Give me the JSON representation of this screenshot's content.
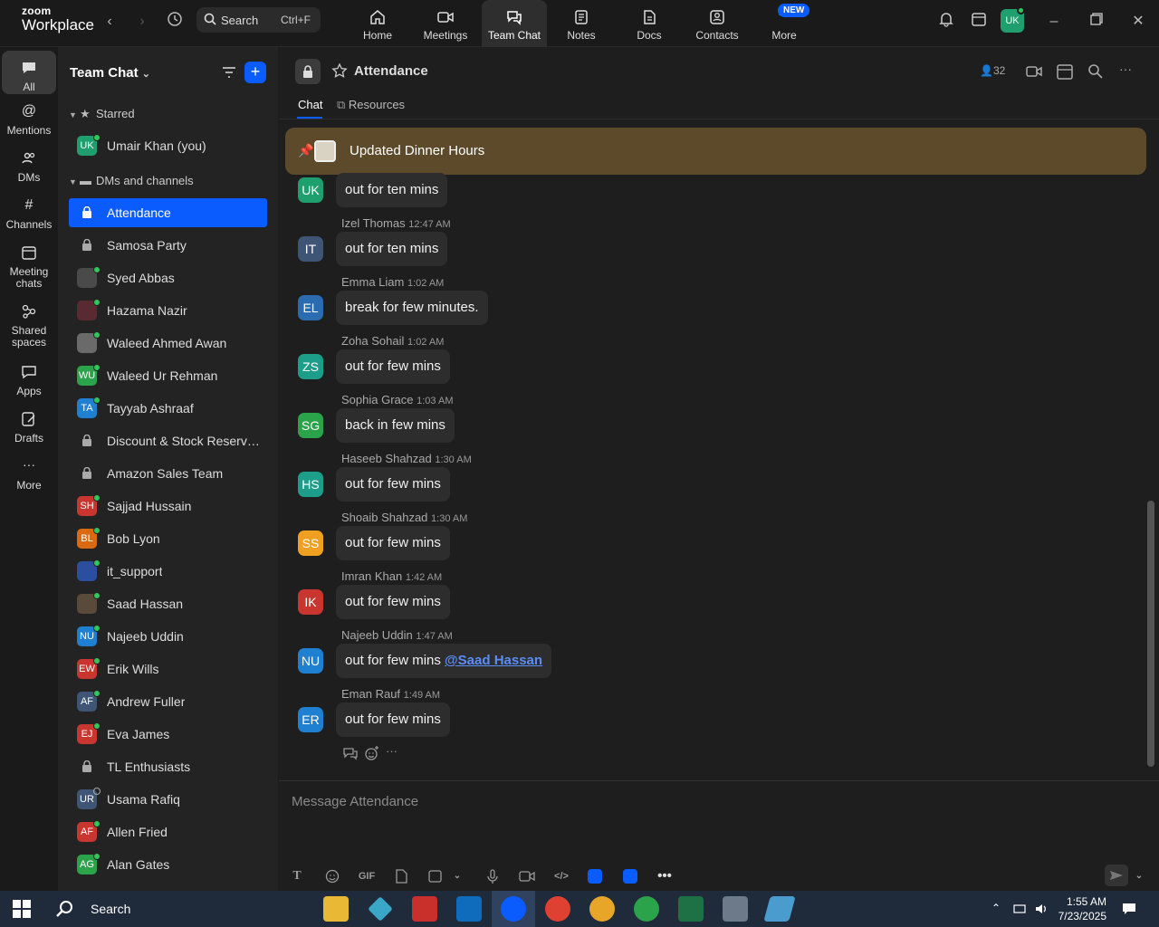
{
  "app": {
    "brand_line1": "zoom",
    "brand_line2": "Workplace"
  },
  "top": {
    "search_label": "Search",
    "search_shortcut": "Ctrl+F",
    "nav": [
      {
        "label": "Home"
      },
      {
        "label": "Meetings"
      },
      {
        "label": "Team Chat"
      },
      {
        "label": "Notes"
      },
      {
        "label": "Docs"
      },
      {
        "label": "Contacts"
      },
      {
        "label": "More"
      }
    ],
    "new_badge": "NEW",
    "user_initials": "UK"
  },
  "rail": [
    {
      "label": "All"
    },
    {
      "label": "Mentions"
    },
    {
      "label": "DMs"
    },
    {
      "label": "Channels"
    },
    {
      "label": "Meeting chats"
    },
    {
      "label": "Shared spaces"
    },
    {
      "label": "Apps"
    },
    {
      "label": "Drafts"
    },
    {
      "label": "More"
    }
  ],
  "sidebar": {
    "title": "Team Chat",
    "starred_label": "Starred",
    "dms_label": "DMs and channels",
    "starred": [
      {
        "initials": "UK",
        "name": "Umair Khan (you)",
        "color": "#1f9e6e"
      }
    ],
    "items": [
      {
        "type": "channel",
        "name": "Attendance"
      },
      {
        "type": "channel",
        "name": "Samosa Party"
      },
      {
        "type": "photo",
        "name": "Syed Abbas",
        "color": "#4a4a4a"
      },
      {
        "type": "photo",
        "name": "Hazama Nazir",
        "color": "#5a2a33"
      },
      {
        "type": "photo",
        "name": "Waleed Ahmed Awan",
        "color": "#6a6a6a"
      },
      {
        "type": "user",
        "initials": "WU",
        "name": "Waleed Ur Rehman",
        "color": "#2aa34a"
      },
      {
        "type": "user",
        "initials": "TA",
        "name": "Tayyab Ashraaf",
        "color": "#1f7fd1"
      },
      {
        "type": "channel",
        "name": "Discount & Stock Reservati..."
      },
      {
        "type": "channel",
        "name": "Amazon Sales Team"
      },
      {
        "type": "user",
        "initials": "SH",
        "name": "Sajjad Hussain",
        "color": "#c9352f"
      },
      {
        "type": "user",
        "initials": "BL",
        "name": "Bob Lyon",
        "color": "#d96a12"
      },
      {
        "type": "photo",
        "name": "it_support",
        "color": "#2b4f9e"
      },
      {
        "type": "photo",
        "name": "Saad Hassan",
        "color": "#5a4a3a"
      },
      {
        "type": "user",
        "initials": "NU",
        "name": "Najeeb Uddin",
        "color": "#1f7fd1"
      },
      {
        "type": "user",
        "initials": "EW",
        "name": "Erik Wills",
        "color": "#c9352f"
      },
      {
        "type": "user",
        "initials": "AF",
        "name": "Andrew Fuller",
        "color": "#3e5576"
      },
      {
        "type": "user",
        "initials": "EJ",
        "name": "Eva James",
        "color": "#c9352f"
      },
      {
        "type": "channel",
        "name": "TL Enthusiasts"
      },
      {
        "type": "user",
        "initials": "UR",
        "name": "Usama Rafiq",
        "color": "#3e5576",
        "offline": true
      },
      {
        "type": "user",
        "initials": "AF",
        "name": "Allen Fried",
        "color": "#c9352f"
      },
      {
        "type": "user",
        "initials": "AG",
        "name": "Alan Gates",
        "color": "#2aa34a"
      }
    ]
  },
  "channel": {
    "name": "Attendance",
    "member_count": "32",
    "tabs": [
      "Chat",
      "Resources"
    ],
    "pinned": "Updated Dinner Hours"
  },
  "messages": [
    {
      "initials": "UK",
      "color": "#1f9e6e",
      "sender": "",
      "time": "",
      "text": "out for ten mins"
    },
    {
      "initials": "IT",
      "color": "#3e5576",
      "sender": "Izel Thomas",
      "time": "12:47 AM",
      "text": "out for ten mins"
    },
    {
      "initials": "EL",
      "color": "#2b6cb0",
      "sender": "Emma Liam",
      "time": "1:02 AM",
      "text": "break for few minutes."
    },
    {
      "initials": "ZS",
      "color": "#1c9e8a",
      "sender": "Zoha Sohail",
      "time": "1:02 AM",
      "text": "out for few mins"
    },
    {
      "initials": "SG",
      "color": "#2aa34a",
      "sender": "Sophia Grace",
      "time": "1:03 AM",
      "text": "back in few mins"
    },
    {
      "initials": "HS",
      "color": "#1c9e8a",
      "sender": "Haseeb Shahzad",
      "time": "1:30 AM",
      "text": "out for few mins"
    },
    {
      "initials": "SS",
      "color": "#f0a020",
      "sender": "Shoaib Shahzad",
      "time": "1:30 AM",
      "text": "out for few mins"
    },
    {
      "initials": "IK",
      "color": "#c9352f",
      "sender": "Imran Khan",
      "time": "1:42 AM",
      "text": "out for few mins"
    },
    {
      "initials": "NU",
      "color": "#1f7fd1",
      "sender": "Najeeb Uddin",
      "time": "1:47 AM",
      "text": "out for few mins",
      "mention": "@Saad Hassan"
    },
    {
      "initials": "ER",
      "color": "#1f7fd1",
      "sender": "Eman Rauf",
      "time": "1:49 AM",
      "text": "out for few mins"
    }
  ],
  "composer": {
    "placeholder": "Message Attendance",
    "gif_label": "GIF"
  },
  "taskbar": {
    "search_label": "Search",
    "time": "1:55 AM",
    "date": "7/23/2025"
  }
}
